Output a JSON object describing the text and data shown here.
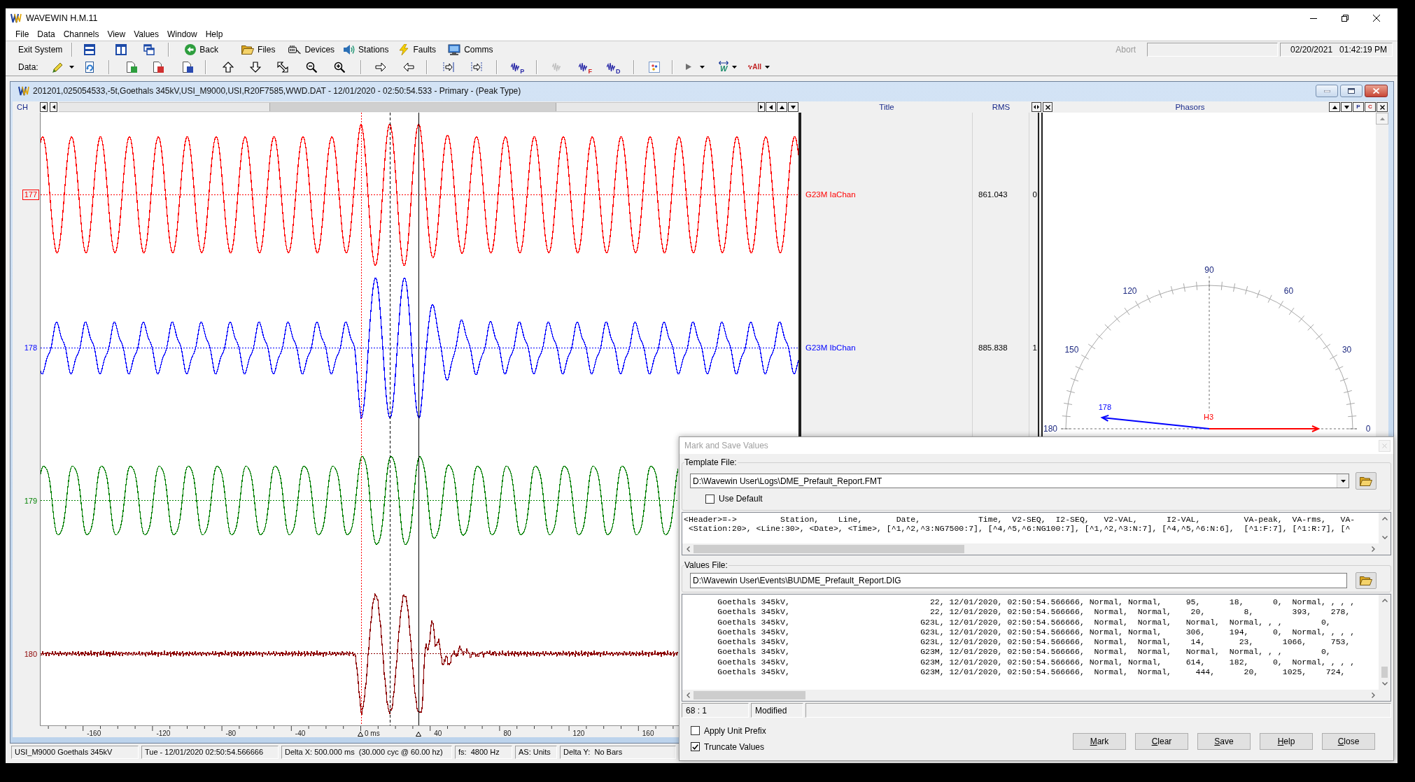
{
  "window": {
    "title": "WAVEWIN H.M.11"
  },
  "menu": [
    "File",
    "Data",
    "Channels",
    "View",
    "Values",
    "Window",
    "Help"
  ],
  "toolbar": {
    "exit": "Exit System",
    "buttons": [
      "Back",
      "Files",
      "Devices",
      "Stations",
      "Faults",
      "Comms"
    ],
    "abort": {
      "label": "Abort",
      "disabled": true
    },
    "date": "02/20/2021",
    "time": "01:42:19 PM"
  },
  "data_toolbar": {
    "label": "Data:",
    "icon_letters": [
      "P",
      "F",
      "D",
      "W",
      "All"
    ]
  },
  "record_window": {
    "title": "201201,025054533,-5t,Goethals 345kV,USI_M9000,USI,R20F7585,WWD.DAT - 12/01/2020 - 02:50:54.533 - Primary - (Peak Type)",
    "ch_label": "CH",
    "columns": [
      "Title",
      "RMS",
      "Phasors"
    ],
    "phasor_buttons": [
      "P",
      "C"
    ]
  },
  "channels": [
    {
      "number": "177",
      "color": "#ff0000",
      "selected": true,
      "title": "G23M IaChan",
      "rms": "861.043",
      "column_3": "0"
    },
    {
      "number": "178",
      "color": "#0000ff",
      "selected": false,
      "title": "G23M IbChan",
      "rms": "885.838",
      "column_3": "1"
    },
    {
      "number": "179",
      "color": "#008000",
      "selected": false
    },
    {
      "number": "180",
      "color": "#8b0000",
      "selected": false
    }
  ],
  "time_axis": [
    "-160",
    "-120",
    "-80",
    "-40",
    "0 ms",
    "40",
    "80",
    "120",
    "160"
  ],
  "phasors": {
    "angles": [
      "90",
      "120",
      "60",
      "150",
      "30",
      "180",
      "0"
    ],
    "center_label": "H3",
    "vectors": [
      {
        "label": "178",
        "color": "#0000ff"
      },
      {
        "color": "#ff0000"
      }
    ]
  },
  "status_bar": [
    "USI_M9000 Goethals 345kV",
    "Tue - 12/01/2020 02:50:54.566666",
    "Delta X: 500.000 ms  (30.000 cyc @ 60.00 hz)",
    "fs:  4800 Hz",
    "AS: Units",
    "Delta Y:  No Bars"
  ],
  "dialog": {
    "title": "Mark and Save Values",
    "template": {
      "label": "Template File:",
      "value": "D:\\Wavewin User\\Logs\\DME_Prefault_Report.FMT",
      "use_default": {
        "label": "Use Default",
        "checked": false
      },
      "lines": [
        "<Header>=->         Station,    Line,       Date,            Time,  V2-SEQ,  I2-SEQ,   V2-VAL,      I2-VAL,         VA-peak,  VA-rms,   VA-",
        " <Station:20>, <Line:30>, <Date>, <Time>, [^1,^2,^3:NG7500:7], [^4,^5,^6:NG100:7], [^1,^2,^3:N:7], [^4,^5,^6:N:6],  [^1:F:7], [^1:R:7], [^"
      ]
    },
    "values": {
      "label": "Values File:",
      "value": "D:\\Wavewin User\\Events\\BU\\DME_Prefault_Report.DIG",
      "lines": [
        "       Goethals 345kV,                             22, 12/01/2020, 02:50:54.566666, Normal, Normal,     95,      18,      0,  Normal, , , ,",
        "       Goethals 345kV,                             22, 12/01/2020, 02:50:54.566666,  Normal,  Normal,    20,        8,        393,    278,",
        "       Goethals 345kV,                           G23L, 12/01/2020, 02:50:54.566666,  Normal,  Normal,   Normal,  Normal, , ,        0,",
        "       Goethals 345kV,                           G23L, 12/01/2020, 02:50:54.566666, Normal, Normal,     306,     194,     0,  Normal, , , ,",
        "       Goethals 345kV,                           G23L, 12/01/2020, 02:50:54.566666,  Normal,  Normal,    14,       23,      1066,     753,",
        "       Goethals 345kV,                           G23M, 12/01/2020, 02:50:54.566666,  Normal,  Normal,   Normal,  Normal, , ,        0,",
        "       Goethals 345kV,                           G23M, 12/01/2020, 02:50:54.566666, Normal, Normal,     614,     182,     0,  Normal, , , ,",
        "       Goethals 345kV,                           G23M, 12/01/2020, 02:50:54.566666,  Normal,  Normal,     444,      20,     1025,    724,"
      ]
    },
    "status": [
      "68 : 1",
      "Modified"
    ],
    "options": [
      {
        "label": "Apply Unit Prefix",
        "checked": false
      },
      {
        "label": "Truncate Values",
        "checked": true
      }
    ],
    "buttons": [
      "Mark",
      "Clear",
      "Save",
      "Help",
      "Close"
    ]
  }
}
